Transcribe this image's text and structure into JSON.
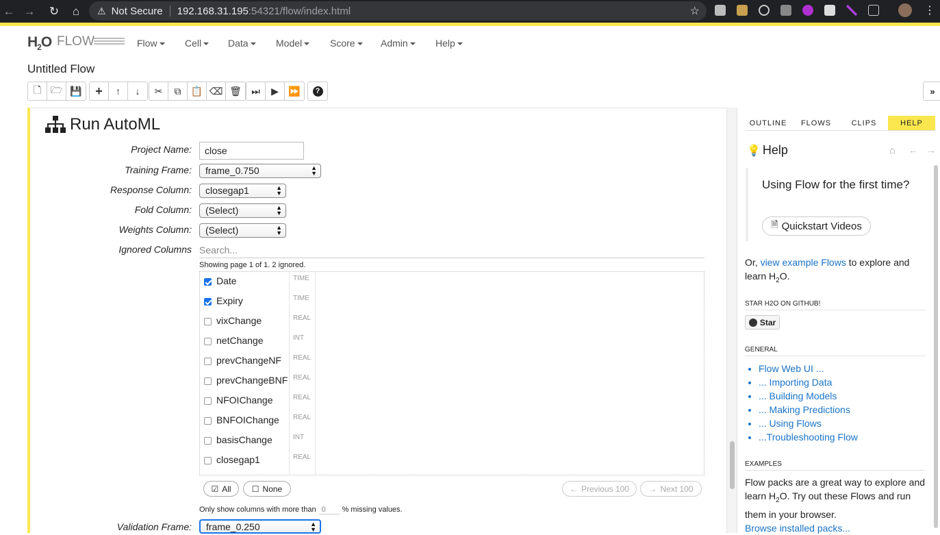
{
  "browser": {
    "security_label": "Not Secure",
    "url_host": "192.168.31.195",
    "url_rest": ":54321/flow/index.html"
  },
  "app": {
    "logo_h": "H",
    "logo_2": "2",
    "logo_o": "O",
    "logo_flow": "FLOW",
    "menus": [
      "Flow",
      "Cell",
      "Data",
      "Model",
      "Score",
      "Admin",
      "Help"
    ],
    "flow_title": "Untitled Flow"
  },
  "automl": {
    "title": "Run AutoML",
    "project_name_label": "Project Name:",
    "project_name_value": "close",
    "training_frame_label": "Training Frame:",
    "training_frame_value": "frame_0.750",
    "response_column_label": "Response Column:",
    "response_column_value": "closegap1",
    "fold_column_label": "Fold Column:",
    "fold_column_value": "(Select)",
    "weights_column_label": "Weights Column:",
    "weights_column_value": "(Select)",
    "ignored_columns_label": "Ignored Columns",
    "search_placeholder": "Search...",
    "showing_text": "Showing page 1 of 1. 2 ignored.",
    "columns": [
      {
        "name": "Date",
        "type": "TIME",
        "checked": true
      },
      {
        "name": "Expiry",
        "type": "TIME",
        "checked": true
      },
      {
        "name": "vixChange",
        "type": "REAL",
        "checked": false
      },
      {
        "name": "netChange",
        "type": "INT",
        "checked": false
      },
      {
        "name": "prevChangeNF",
        "type": "REAL",
        "checked": false
      },
      {
        "name": "prevChangeBNF",
        "type": "REAL",
        "checked": false
      },
      {
        "name": "NFOIChange",
        "type": "REAL",
        "checked": false
      },
      {
        "name": "BNFOIChange",
        "type": "REAL",
        "checked": false
      },
      {
        "name": "basisChange",
        "type": "INT",
        "checked": false
      },
      {
        "name": "closegap1",
        "type": "REAL",
        "checked": false
      }
    ],
    "all_label": "All",
    "none_label": "None",
    "prev_label": "Previous 100",
    "next_label": "Next 100",
    "missing_prefix": "Only show columns with more than",
    "missing_value": "0",
    "missing_suffix": "% missing values.",
    "validation_frame_label": "Validation Frame:",
    "validation_frame_value": "frame_0.250"
  },
  "help_panel": {
    "tabs": [
      "OUTLINE",
      "FLOWS",
      "CLIPS",
      "HELP"
    ],
    "active_tab": "HELP",
    "title": "Help",
    "callout_text": "Using Flow for the first time?",
    "quickstart_label": "Quickstart Videos",
    "or_prefix": "Or, ",
    "or_link": "view example Flows",
    "or_suffix": " to explore and learn H",
    "or_sub": "2",
    "or_end": "O.",
    "star_section": "STAR H2O ON GITHUB!",
    "star_label": "Star",
    "general_section": "GENERAL",
    "general_links": [
      "Flow Web UI ...",
      "... Importing Data",
      "... Building Models",
      "... Making Predictions",
      "... Using Flows",
      "...Troubleshooting Flow"
    ],
    "examples_section": "EXAMPLES",
    "examples_text_1": "Flow packs are a great way to explore and learn H",
    "examples_sub": "2",
    "examples_text_2": "O. Try out these Flows and run them in your browser.",
    "browse_link": "Browse installed packs..."
  }
}
